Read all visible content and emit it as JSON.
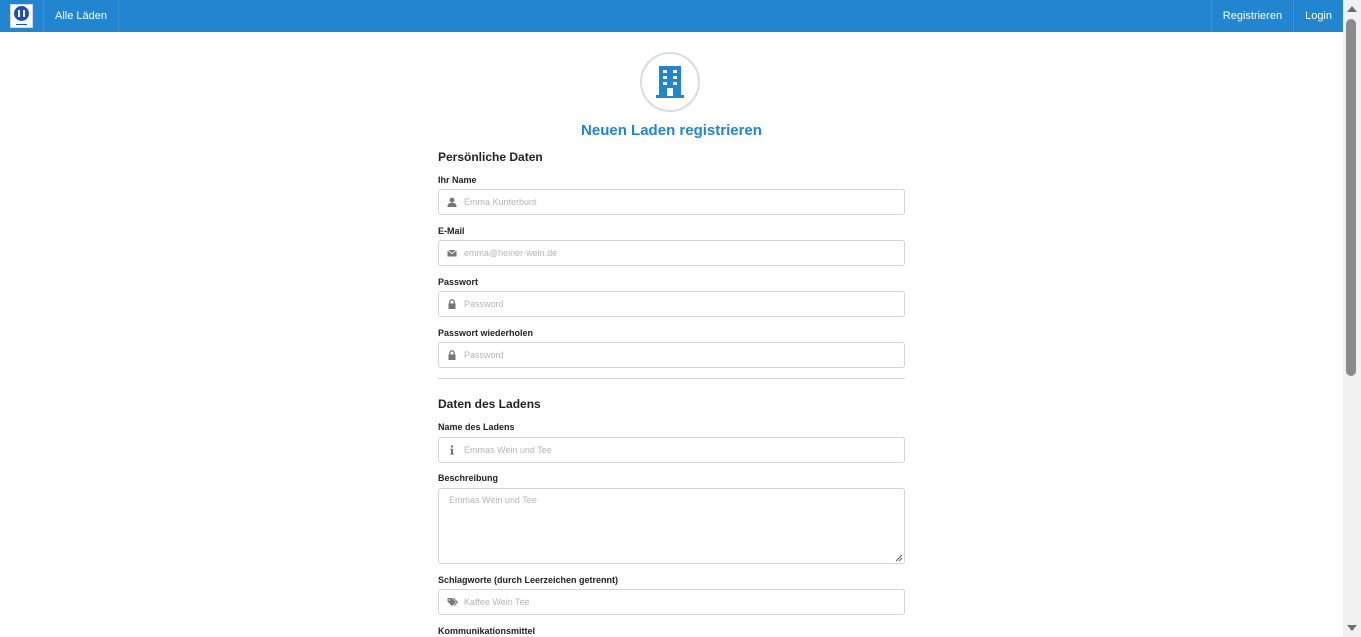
{
  "nav": {
    "logo_icon": "shop-logo",
    "all_shops": "Alle Läden",
    "register": "Registrieren",
    "login": "Login",
    "brand_color": "#2185d0"
  },
  "page": {
    "header_icon": "building-icon",
    "title": "Neuen Laden registrieren"
  },
  "personal": {
    "section_title": "Persönliche Daten",
    "name": {
      "label": "Ihr Name",
      "placeholder": "Emma Kunterbunt",
      "icon": "user-icon"
    },
    "email": {
      "label": "E-Mail",
      "placeholder": "emma@heiner-wein.de",
      "icon": "envelope-icon"
    },
    "password": {
      "label": "Passwort",
      "placeholder": "Password",
      "icon": "lock-icon"
    },
    "password_repeat": {
      "label": "Passwort wiederholen",
      "placeholder": "Password",
      "icon": "lock-icon"
    }
  },
  "shop": {
    "section_title": "Daten des Ladens",
    "shop_name": {
      "label": "Name des Ladens",
      "placeholder": "Emmas Wein und Tee",
      "icon": "info-icon"
    },
    "description": {
      "label": "Beschreibung",
      "placeholder": "Emmas Wein und Tee"
    },
    "tags": {
      "label": "Schlagworte (durch Leerzeichen getrennt)",
      "placeholder": "Kaffee Wein Tee",
      "icon": "tags-icon"
    },
    "communication": {
      "label": "Kommunikationsmittel"
    }
  }
}
